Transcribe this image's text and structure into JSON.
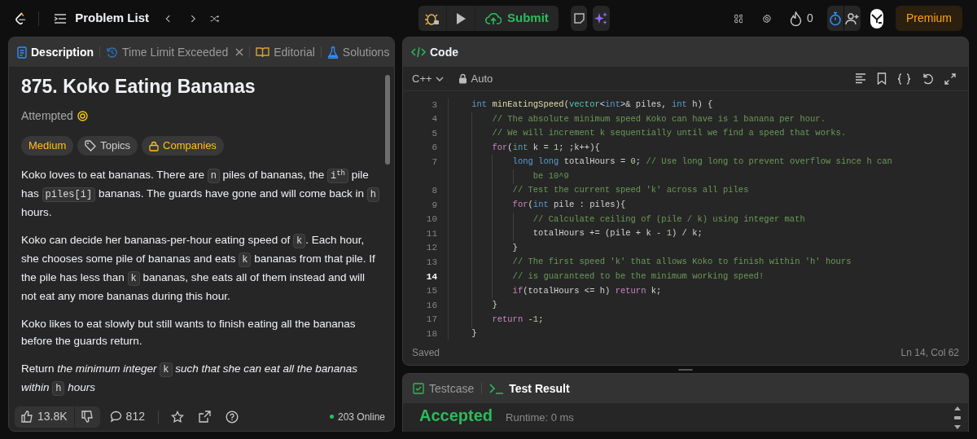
{
  "top_bar": {
    "nav_label": "Problem List",
    "submit_label": "Submit",
    "streak": "0",
    "premium_label": "Premium"
  },
  "description_panel": {
    "tabs": [
      {
        "label": "Description",
        "selected": true,
        "kind": "description"
      },
      {
        "label": "Time Limit Exceeded",
        "selected": false,
        "kind": "submission",
        "closable": true
      },
      {
        "label": "Editorial",
        "selected": false,
        "kind": "editorial"
      },
      {
        "label": "Solutions",
        "selected": false,
        "kind": "solutions"
      }
    ],
    "title": "875. Koko Eating Bananas",
    "status": "Attempted",
    "tags": [
      {
        "label": "Medium",
        "kind": "difficulty"
      },
      {
        "label": "Topics",
        "kind": "topics"
      },
      {
        "label": "Companies",
        "kind": "companies"
      }
    ],
    "paragraphs": [
      [
        {
          "kind": "text",
          "t": "Koko loves to eat bananas. There are "
        },
        {
          "kind": "code",
          "t": "n"
        },
        {
          "kind": "text",
          "t": " piles of bananas, the "
        },
        {
          "kind": "code",
          "t": "i$^{th}$"
        },
        {
          "kind": "text",
          "t": " pile has "
        },
        {
          "kind": "code",
          "t": "piles[i]"
        },
        {
          "kind": "text",
          "t": " bananas. The guards have gone and will come back in "
        },
        {
          "kind": "code",
          "t": "h"
        },
        {
          "kind": "text",
          "t": " hours."
        }
      ],
      [
        {
          "kind": "text",
          "t": "Koko can decide her bananas-per-hour eating speed of "
        },
        {
          "kind": "code",
          "t": "k"
        },
        {
          "kind": "text",
          "t": ". Each hour, she chooses some pile of bananas and eats "
        },
        {
          "kind": "code",
          "t": "k"
        },
        {
          "kind": "text",
          "t": " bananas from that pile. If the pile has less than "
        },
        {
          "kind": "code",
          "t": "k"
        },
        {
          "kind": "text",
          "t": " bananas, she eats all of them instead and will not eat any more bananas during this hour."
        }
      ],
      [
        {
          "kind": "text",
          "t": "Koko likes to eat slowly but still wants to finish eating all the bananas before the guards return."
        }
      ],
      [
        {
          "kind": "text",
          "t": "Return "
        },
        {
          "kind": "italic",
          "t": "the minimum integer "
        },
        {
          "kind": "code",
          "t": "k"
        },
        {
          "kind": "italic",
          "t": " such that she can eat all the bananas within "
        },
        {
          "kind": "code",
          "t": "h"
        },
        {
          "kind": "italic",
          "t": " hours"
        }
      ]
    ],
    "footer": {
      "likes": "13.8K",
      "comments": "812",
      "online": "203 Online"
    }
  },
  "editor": {
    "tab": "Code",
    "language": "C++",
    "mode": "Auto",
    "lines": [
      {
        "number": "3",
        "current": false,
        "tokens": [
          {
            "kind": "kw",
            "t": "int"
          },
          {
            "kind": "fn",
            "t": " minEatingSpeed"
          },
          {
            "kind": "p",
            "t": "("
          },
          {
            "kind": "type",
            "t": "vector"
          },
          {
            "kind": "p",
            "t": "<"
          },
          {
            "kind": "kw",
            "t": "int"
          },
          {
            "kind": "p",
            "t": ">& piles, "
          },
          {
            "kind": "kw",
            "t": "int"
          },
          {
            "kind": "p",
            "t": " h) {"
          }
        ],
        "children": [
          {
            "number": "4",
            "current": false,
            "tokens": [
              {
                "kind": "com",
                "t": "// The absolute minimum speed Koko can have is 1 banana per hour."
              }
            ]
          },
          {
            "number": "5",
            "current": false,
            "tokens": [
              {
                "kind": "com",
                "t": "// We will increment k sequentially until we find a speed that works."
              }
            ]
          },
          {
            "number": "6",
            "current": false,
            "tokens": [
              {
                "kind": "ctl",
                "t": "for"
              },
              {
                "kind": "p",
                "t": "("
              },
              {
                "kind": "kw",
                "t": "int"
              },
              {
                "kind": "p",
                "t": " k = "
              },
              {
                "kind": "num",
                "t": "1"
              },
              {
                "kind": "p",
                "t": "; ;k++){"
              }
            ],
            "children": [
              {
                "number": "7",
                "current": false,
                "tokens": [
                  {
                    "kind": "kw",
                    "t": "long long"
                  },
                  {
                    "kind": "p",
                    "t": " totalHours = "
                  },
                  {
                    "kind": "num",
                    "t": "0"
                  },
                  {
                    "kind": "p",
                    "t": "; "
                  },
                  {
                    "kind": "com",
                    "t": "// Use long long to prevent overflow since h can"
                  }
                ],
                "wrap": [
                  {
                    "kind": "com",
                    "t": "be 10^9"
                  }
                ]
              },
              {
                "number": "8",
                "current": false,
                "tokens": [
                  {
                    "kind": "com",
                    "t": "// Test the current speed 'k' across all piles"
                  }
                ]
              },
              {
                "number": "9",
                "current": false,
                "tokens": [
                  {
                    "kind": "ctl",
                    "t": "for"
                  },
                  {
                    "kind": "p",
                    "t": "("
                  },
                  {
                    "kind": "kw",
                    "t": "int"
                  },
                  {
                    "kind": "p",
                    "t": " pile : piles){"
                  }
                ],
                "children": [
                  {
                    "number": "10",
                    "current": false,
                    "tokens": [
                      {
                        "kind": "com",
                        "t": "// Calculate ceiling of (pile / k) using integer math"
                      }
                    ]
                  },
                  {
                    "number": "11",
                    "current": false,
                    "tokens": [
                      {
                        "kind": "p",
                        "t": "totalHours += (pile + k - "
                      },
                      {
                        "kind": "num",
                        "t": "1"
                      },
                      {
                        "kind": "p",
                        "t": ") / k;"
                      }
                    ]
                  }
                ]
              },
              {
                "number": "12",
                "current": false,
                "tokens": [
                  {
                    "kind": "p",
                    "t": "}"
                  }
                ]
              },
              {
                "number": "13",
                "current": false,
                "tokens": [
                  {
                    "kind": "com",
                    "t": "// The first speed 'k' that allows Koko to finish within 'h' hours"
                  }
                ]
              },
              {
                "number": "14",
                "current": true,
                "tokens": [
                  {
                    "kind": "com",
                    "t": "// is guaranteed to be the minimum working speed!"
                  }
                ]
              },
              {
                "number": "15",
                "current": false,
                "tokens": [
                  {
                    "kind": "ctl",
                    "t": "if"
                  },
                  {
                    "kind": "p",
                    "t": "(totalHours <= h) "
                  },
                  {
                    "kind": "ctl",
                    "t": "return"
                  },
                  {
                    "kind": "p",
                    "t": " k;"
                  }
                ]
              }
            ]
          },
          {
            "number": "16",
            "current": false,
            "tokens": [
              {
                "kind": "p",
                "t": "}"
              }
            ]
          },
          {
            "number": "17",
            "current": false,
            "tokens": [
              {
                "kind": "ctl",
                "t": "return"
              },
              {
                "kind": "p",
                "t": " -"
              },
              {
                "kind": "num",
                "t": "1"
              },
              {
                "kind": "p",
                "t": ";"
              }
            ]
          }
        ]
      },
      {
        "number": "18",
        "current": false,
        "tokens": [
          {
            "kind": "p",
            "t": "}"
          }
        ]
      }
    ],
    "save_status": "Saved",
    "cursor": "Ln 14, Col 62"
  },
  "console": {
    "tabs": [
      {
        "label": "Testcase",
        "selected": false,
        "kind": "testcase"
      },
      {
        "label": "Test Result",
        "selected": true,
        "kind": "result"
      }
    ],
    "verdict": "Accepted",
    "runtime": "Runtime: 0 ms"
  }
}
